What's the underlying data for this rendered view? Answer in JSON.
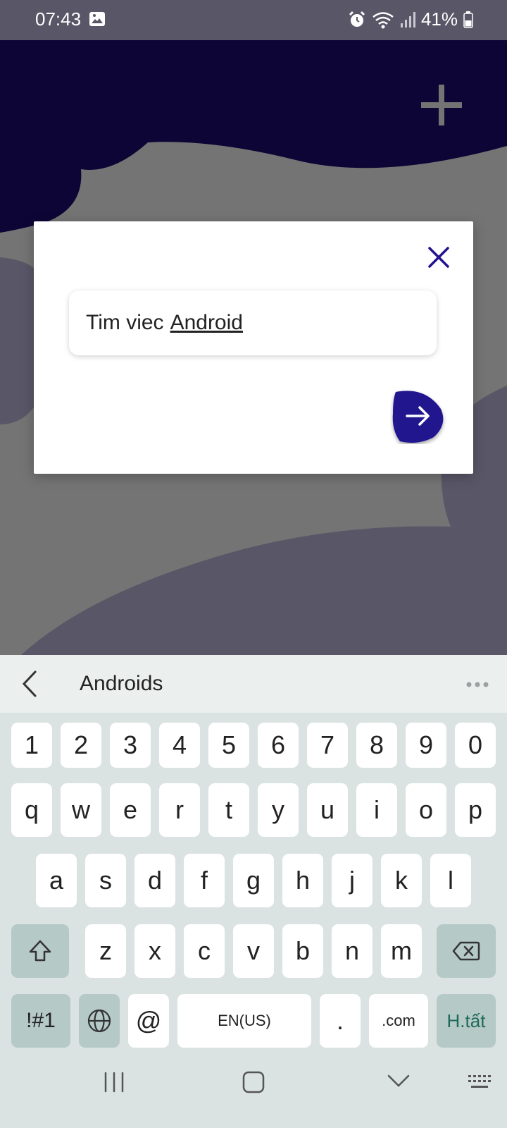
{
  "status_bar": {
    "time": "07:43",
    "battery": "41%"
  },
  "dialog": {
    "input_prefix": "Tim viec",
    "input_word": "Android"
  },
  "keyboard": {
    "suggestion": "Androids",
    "row_numbers": [
      "1",
      "2",
      "3",
      "4",
      "5",
      "6",
      "7",
      "8",
      "9",
      "0"
    ],
    "row_1": [
      "q",
      "w",
      "e",
      "r",
      "t",
      "y",
      "u",
      "i",
      "o",
      "p"
    ],
    "row_2": [
      "a",
      "s",
      "d",
      "f",
      "g",
      "h",
      "j",
      "k",
      "l"
    ],
    "row_3": [
      "z",
      "x",
      "c",
      "v",
      "b",
      "n",
      "m"
    ],
    "symbols_label": "!#1",
    "at_label": "@",
    "space_label": "EN(US)",
    "period_label": ".",
    "dotcom_label": ".com",
    "done_label": "H.tất"
  },
  "colors": {
    "accent": "#22128f",
    "header_dark": "#0d0535",
    "keyboard_bg": "#dbe3e2",
    "done_text": "#1f6a5b"
  }
}
